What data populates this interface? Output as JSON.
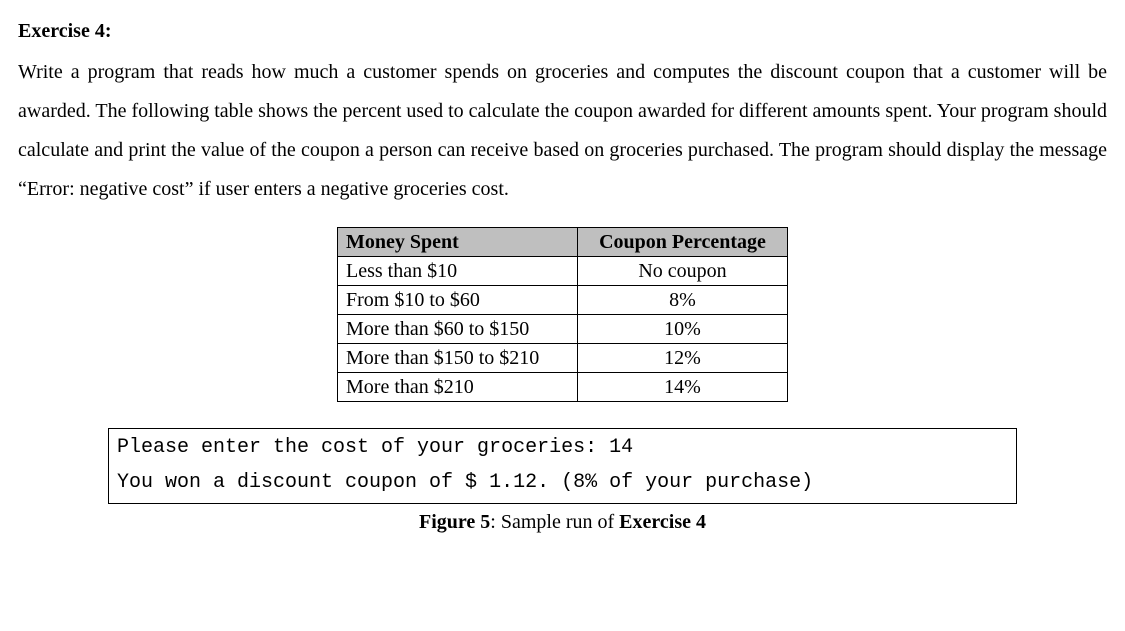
{
  "heading": "Exercise 4:",
  "body": "Write a program that reads how much a customer spends on groceries and computes the discount coupon that a customer will be awarded. The following table shows the percent used to calculate the coupon awarded for different amounts spent. Your program should calculate and print the value of the coupon a person can receive based on groceries purchased. The program should display the message “Error: negative cost” if user enters a negative groceries cost.",
  "table": {
    "headers": {
      "col1": "Money Spent",
      "col2": "Coupon Percentage"
    },
    "rows": [
      {
        "col1": "Less than $10",
        "col2": "No coupon"
      },
      {
        "col1": "From $10 to $60",
        "col2": "8%"
      },
      {
        "col1": "More than $60 to $150",
        "col2": "10%"
      },
      {
        "col1": "More than $150 to $210",
        "col2": "12%"
      },
      {
        "col1": "More than $210",
        "col2": "14%"
      }
    ]
  },
  "sample": {
    "line1": "Please enter the cost of your groceries: 14",
    "line2_prefix": "You won a discount coupon of $ ",
    "line2_amount": "1.12",
    "line2_suffix": ". (8% of your purchase)"
  },
  "caption": {
    "label": "Figure 5",
    "sep": ": Sample run of ",
    "ref": "Exercise 4"
  }
}
